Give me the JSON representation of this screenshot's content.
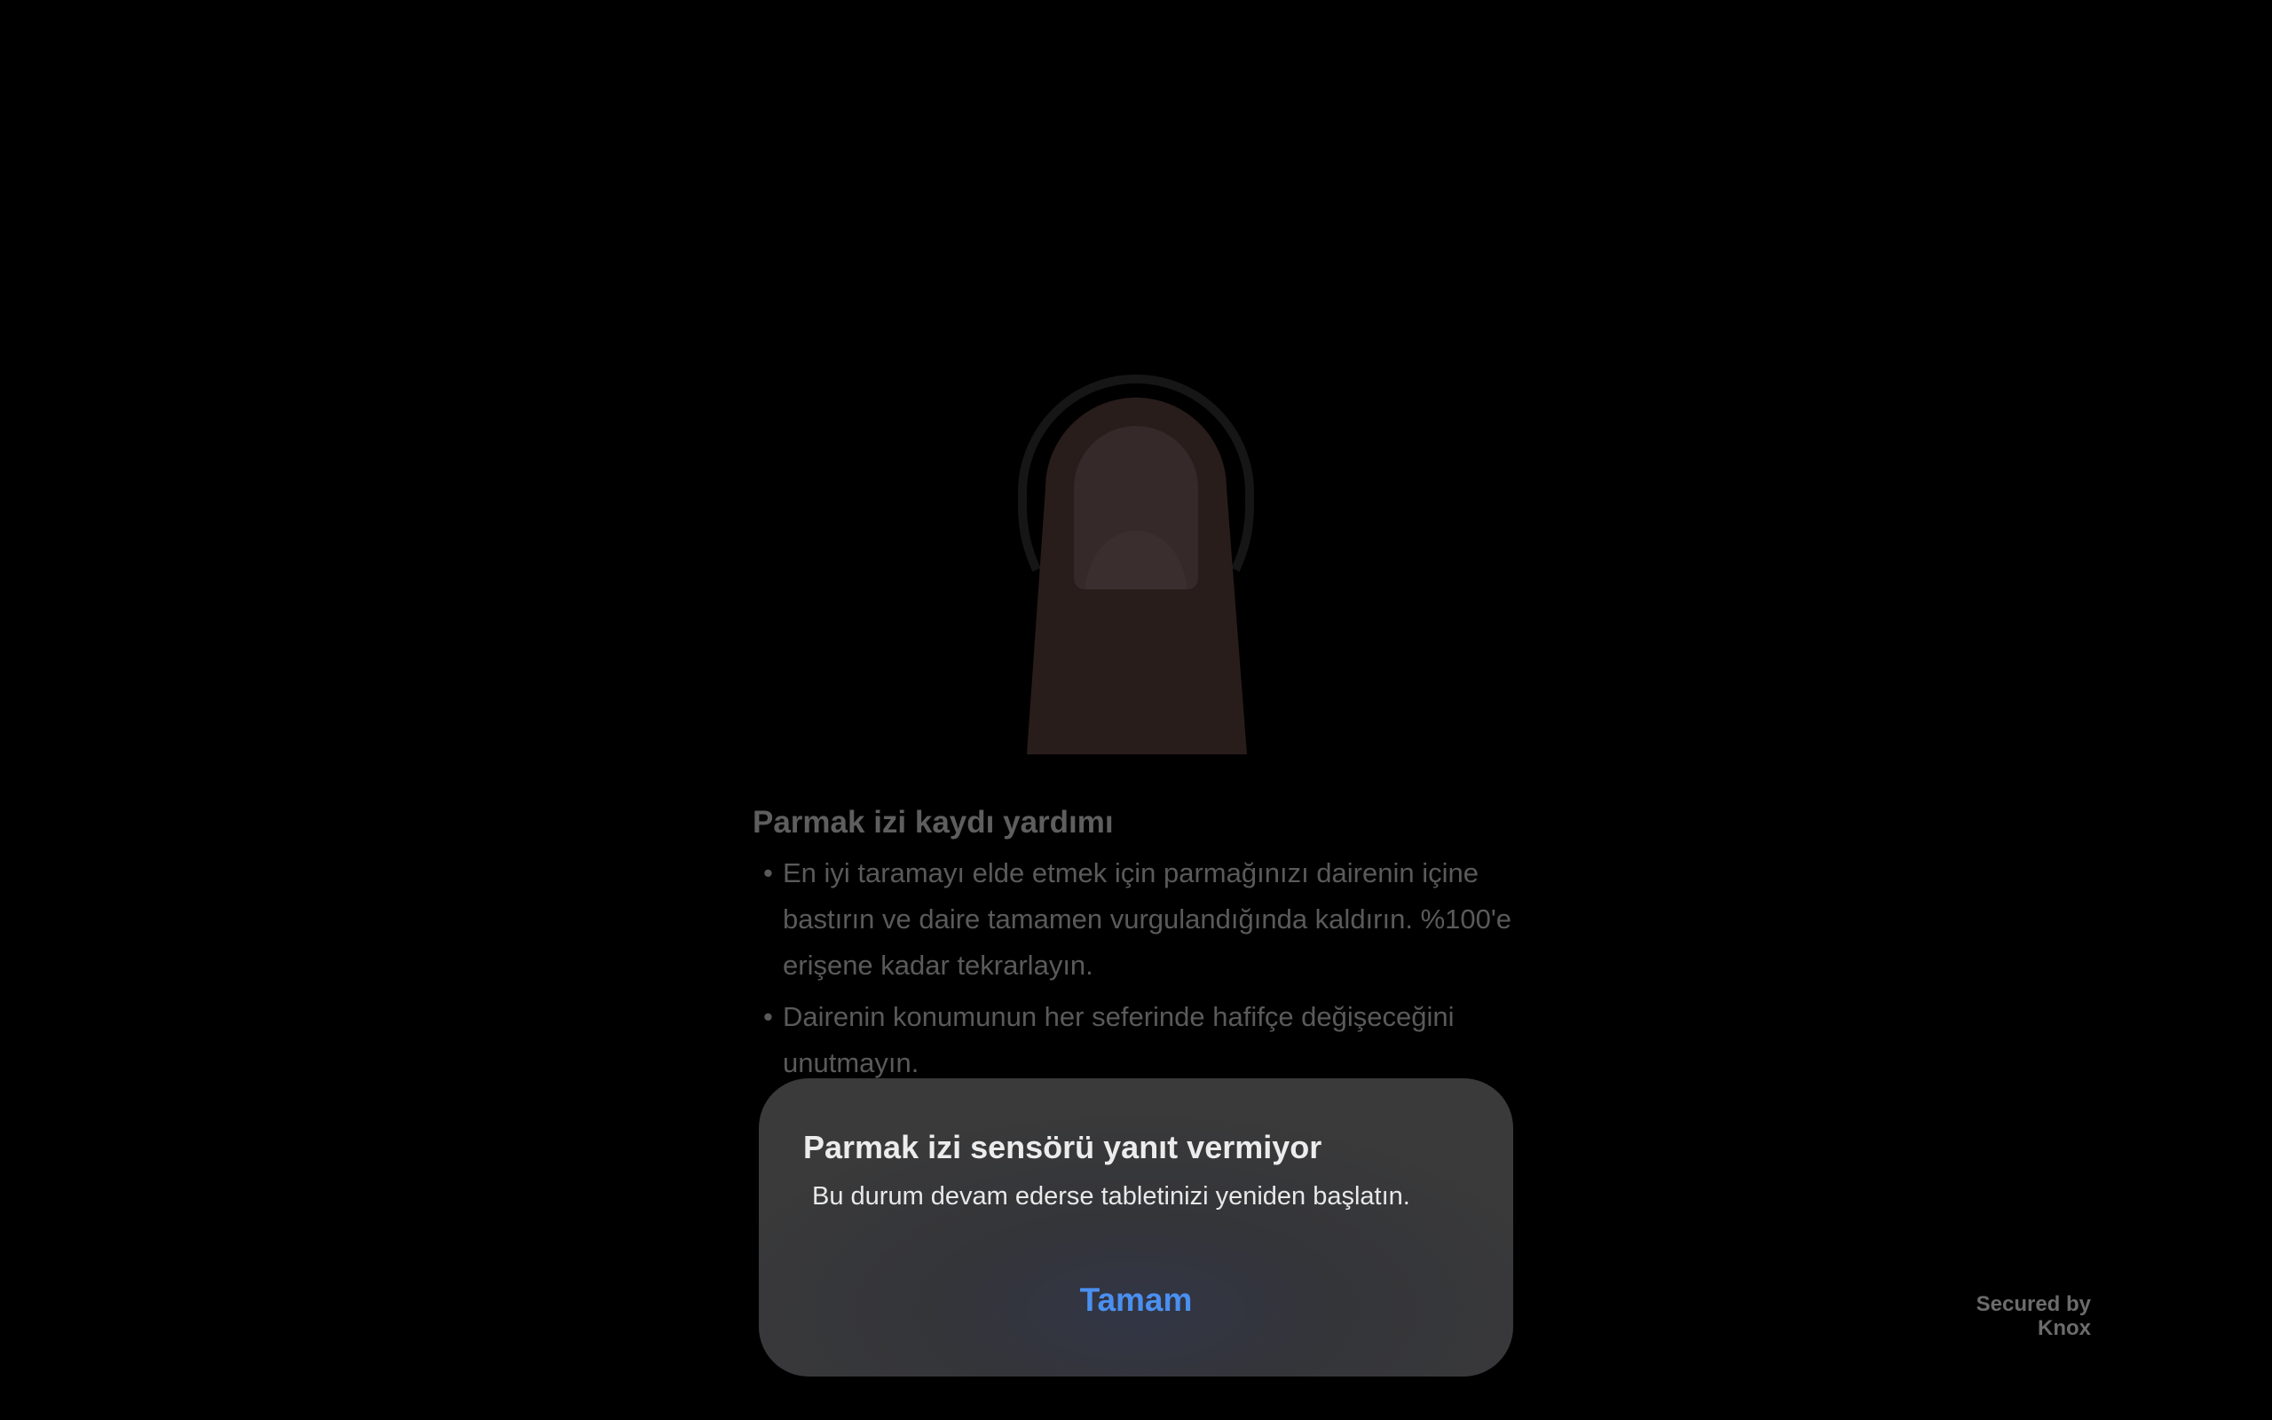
{
  "help": {
    "title": "Parmak izi kaydı yardımı",
    "bullet_symbol": "•",
    "items": [
      "En iyi taramayı elde etmek için parmağınızı dairenin içine bastırın ve daire tamamen vurgulandığında kaldırın. %100'e erişene kadar tekrarlayın.",
      "Dairenin konumunun her seferinde hafifçe değişeceğini unutmayın."
    ]
  },
  "dialog": {
    "title": "Parmak izi sensörü yanıt vermiyor",
    "message": "Bu durum devam ederse tabletinizi yeniden başlatın.",
    "ok_label": "Tamam"
  },
  "knox": {
    "line1": "Secured by",
    "line2": "Knox"
  },
  "icons": {
    "finger": "finger-icon"
  },
  "colors": {
    "background": "#000000",
    "dialog_bg": "#3a3a3a",
    "accent": "#4a90f0",
    "finger": "#2a1e1c"
  }
}
